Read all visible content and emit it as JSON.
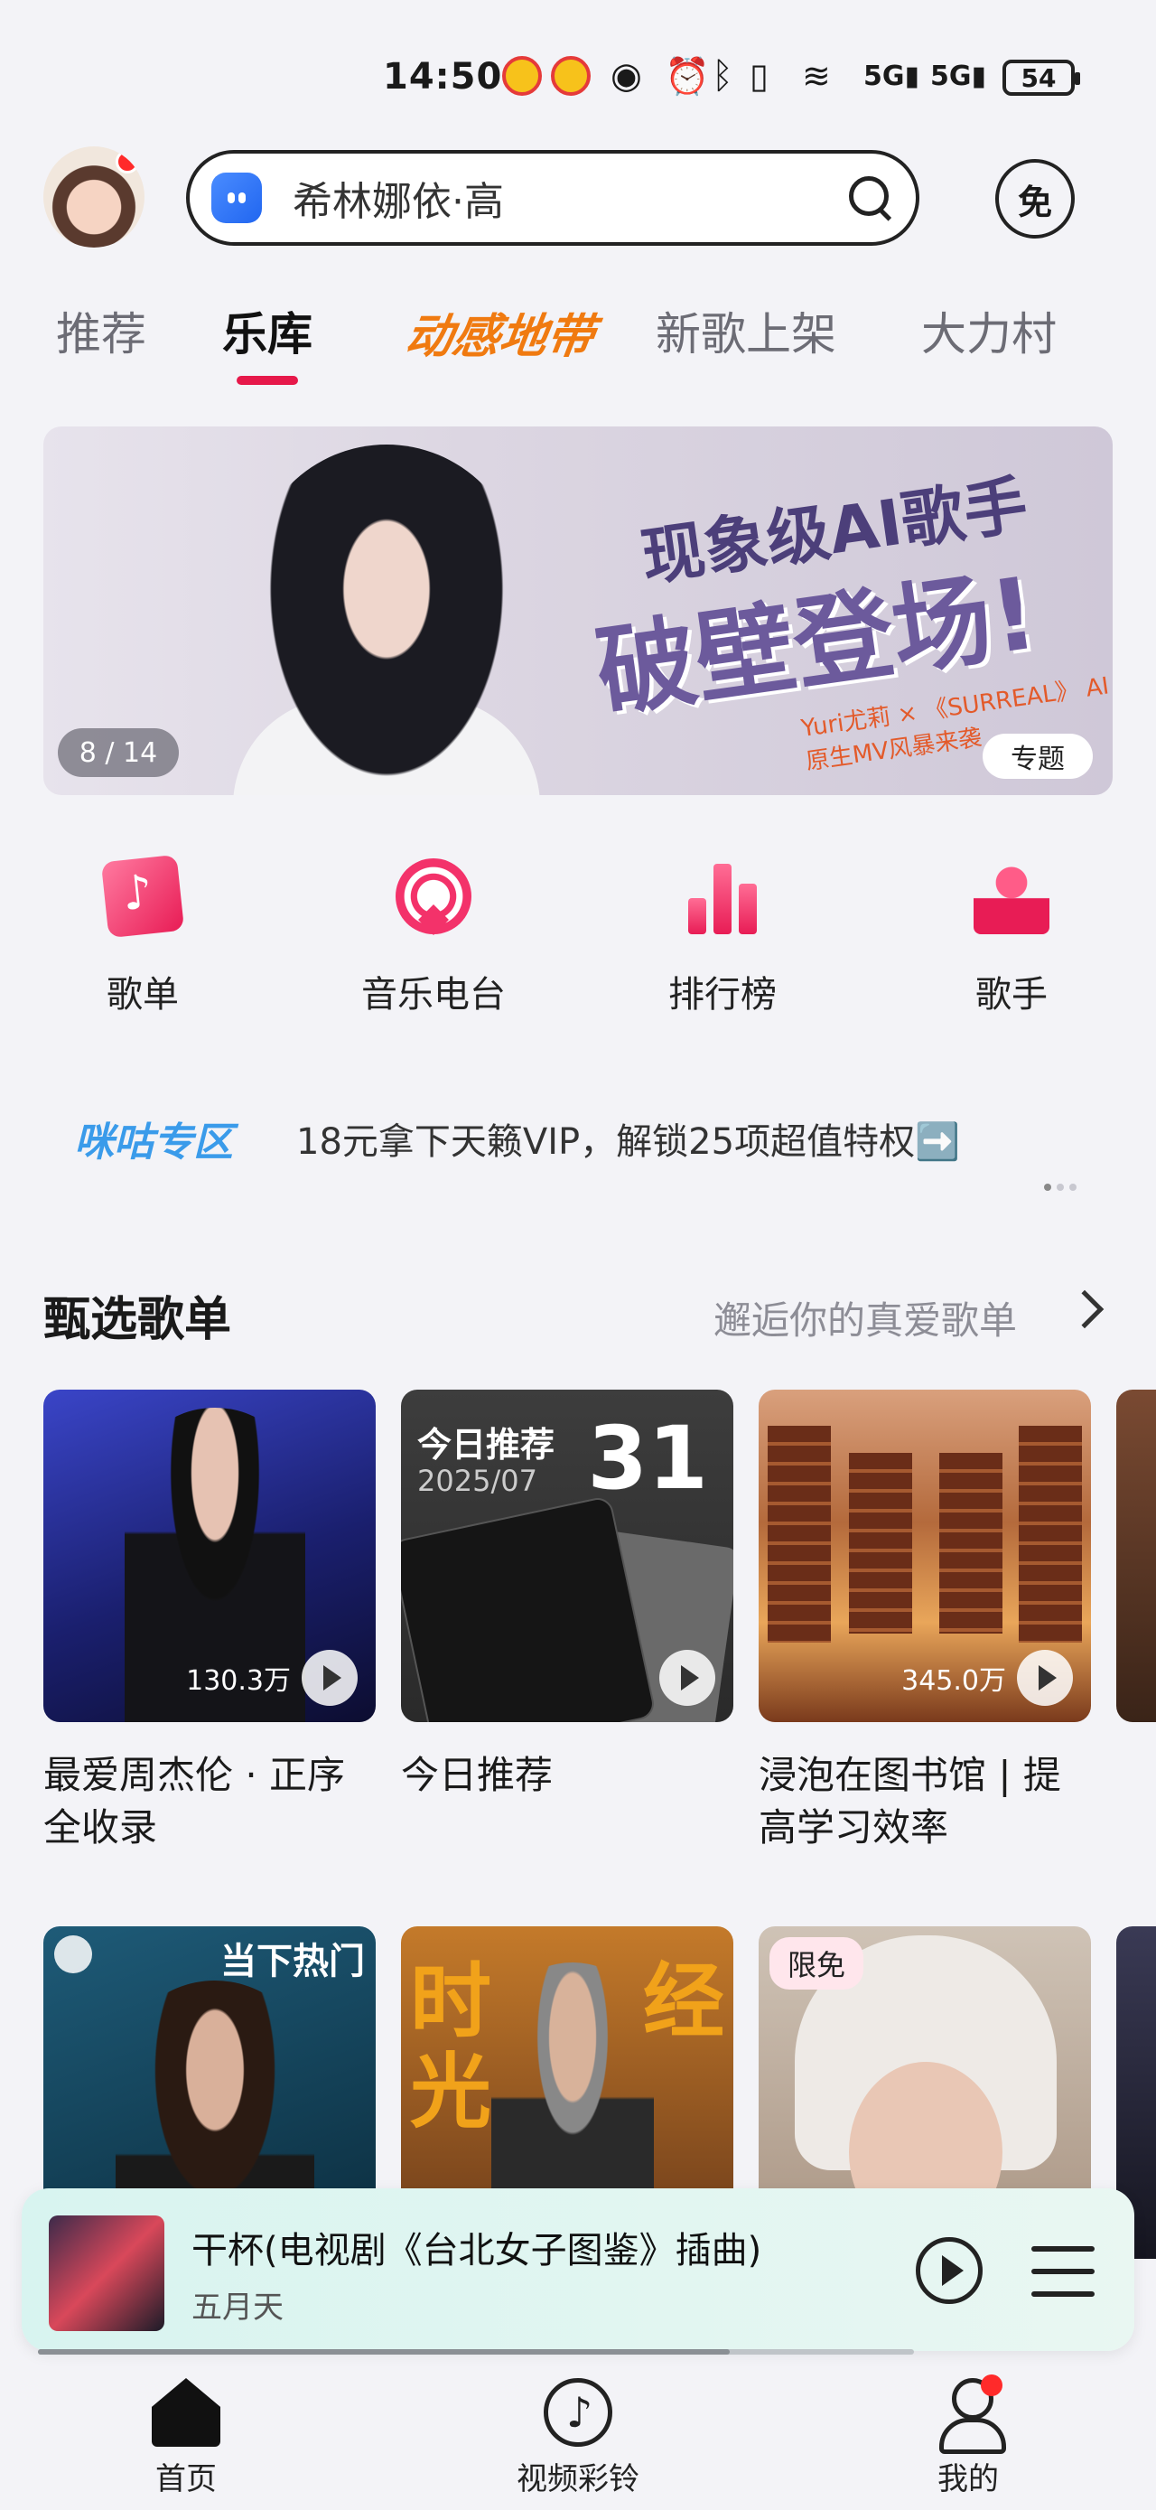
{
  "status": {
    "time": "14:50",
    "battery": "54",
    "network": "5G"
  },
  "header": {
    "search_text": "希林娜依·高",
    "free_label": "免"
  },
  "tabs": [
    {
      "label": "推荐"
    },
    {
      "label": "乐库"
    },
    {
      "label": "动感地带"
    },
    {
      "label": "新歌上架"
    },
    {
      "label": "大力村"
    }
  ],
  "banner": {
    "headline1": "现象级AI歌手",
    "headline2": "破壁登场!",
    "subtext": "Yuri尤莉 × 《SURREAL》 AI原生MV风暴来袭",
    "index": "8 / 14",
    "tag": "专题"
  },
  "quick": [
    {
      "label": "歌单",
      "icon": "playlist-icon"
    },
    {
      "label": "音乐电台",
      "icon": "ai-radio-icon"
    },
    {
      "label": "排行榜",
      "icon": "chart-icon"
    },
    {
      "label": "歌手",
      "icon": "singer-icon"
    }
  ],
  "migu": {
    "tag": "咪咕专区",
    "text": "18元拿下天籁VIP，解锁25项超值特权➡️"
  },
  "section": {
    "title": "甄选歌单",
    "more": "邂逅你的真爱歌单"
  },
  "playlists": [
    {
      "title": "最爱周杰伦 · 正序全收录",
      "plays": "130.3万"
    },
    {
      "title": "今日推荐",
      "cover_title": "今日推荐",
      "cover_date": "2025/07",
      "cover_day": "31"
    },
    {
      "title": "浸泡在图书馆 | 提高学习效率",
      "plays": "345.0万"
    },
    {
      "cover_tag": "当下热门"
    },
    {
      "cover_text_left": "时",
      "cover_text_right": "经",
      "cover_text_left2": "光"
    },
    {
      "cover_tag": "限免"
    }
  ],
  "player": {
    "song": "干杯(电视剧《台北女子图鉴》插曲)",
    "artist": "五月天",
    "progress": 0.79
  },
  "nav": [
    {
      "label": "首页"
    },
    {
      "label": "视频彩铃"
    },
    {
      "label": "我的"
    }
  ]
}
